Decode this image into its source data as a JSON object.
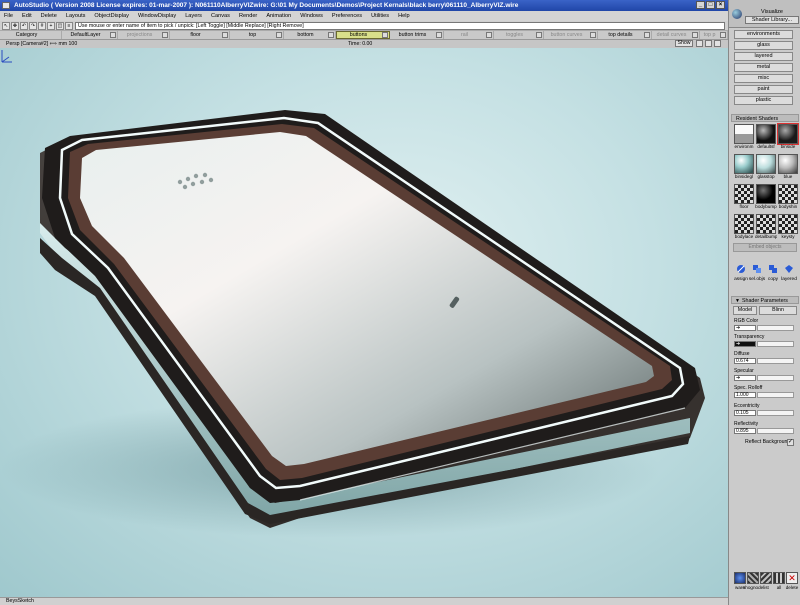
{
  "window": {
    "title": "AutoStudio ( Version 2008  License expires: 01-mar-2007 ): N061110AlberryVIZwire: G:\\01 My Documents\\Demos\\Project Kernals\\black berry\\061110_AlberryVIZ.wire",
    "buttons": [
      "_",
      "□",
      "×"
    ]
  },
  "menu": [
    "File",
    "Edit",
    "Delete",
    "Layouts",
    "ObjectDisplay",
    "WindowDisplay",
    "Layers",
    "Canvas",
    "Render",
    "Animation",
    "Windows",
    "Preferences",
    "Utilities",
    "Help"
  ],
  "prompt": {
    "text": "Use mouse or enter name of item to pick / unpick: [Left Toggle] [Middle Replace] [Right Remove]"
  },
  "shelf": [
    {
      "label": "Category",
      "state": "normal"
    },
    {
      "label": "DefaultLayer",
      "state": "normal"
    },
    {
      "label": "projections",
      "state": "dim"
    },
    {
      "label": "floor",
      "state": "normal"
    },
    {
      "label": "top",
      "state": "normal"
    },
    {
      "label": "bottom",
      "state": "normal"
    },
    {
      "label": "buttons",
      "state": "active"
    },
    {
      "label": "button trims",
      "state": "normal"
    },
    {
      "label": "rail",
      "state": "dim"
    },
    {
      "label": "toggles",
      "state": "dim"
    },
    {
      "label": "button curves",
      "state": "dim"
    },
    {
      "label": "top details",
      "state": "normal"
    },
    {
      "label": "detail curves",
      "state": "dim"
    },
    {
      "label": "top p",
      "state": "dim"
    }
  ],
  "viewinfo": {
    "camera": "Persp [Camera#2]",
    "units_symbol": "⟺ mm",
    "scale": "100",
    "time": "Time: 0.00",
    "show_label": "Show"
  },
  "status": {
    "text": "BeysSketch"
  },
  "visualize": {
    "title": "Visualize",
    "library_button": "Shader Library..."
  },
  "categories": [
    "environments",
    "glass",
    "layered",
    "metal",
    "misc",
    "paint",
    "plastic"
  ],
  "resident_shaders": {
    "title": "Resident Shaders",
    "items": [
      {
        "label": "environm",
        "style": "env",
        "selected": false
      },
      {
        "label": "defaultsf",
        "style": "dark",
        "selected": false
      },
      {
        "label": "binside",
        "style": "darkred",
        "selected": true
      },
      {
        "label": "binsidegl",
        "style": "glass",
        "selected": false
      },
      {
        "label": "glasstop",
        "style": "glass2",
        "selected": false
      },
      {
        "label": "blue",
        "style": "silver",
        "selected": false
      },
      {
        "label": "floor",
        "style": "checker",
        "selected": false
      },
      {
        "label": "bodybump",
        "style": "black",
        "selected": false
      },
      {
        "label": "bodyshin",
        "style": "checker",
        "selected": false
      },
      {
        "label": "bodylace",
        "style": "checker",
        "selected": false
      },
      {
        "label": "detailbump",
        "style": "checker",
        "selected": false
      },
      {
        "label": "keysty",
        "style": "checker",
        "selected": false
      }
    ],
    "embedded_label": "Embed objects"
  },
  "shader_tools": [
    {
      "label": "assign",
      "icon": "assign-icon"
    },
    {
      "label": "sel.objs",
      "icon": "select-objects-icon"
    },
    {
      "label": "copy",
      "icon": "copy-icon"
    },
    {
      "label": "layered",
      "icon": "layered-icon"
    }
  ],
  "shader_params": {
    "title": "Shader Parameters",
    "model_label": "Model",
    "model_value": "Blinn",
    "params": [
      {
        "label": "RGB Color",
        "value": "",
        "arrow": true
      },
      {
        "label": "Transparency",
        "value": "",
        "arrow": true
      },
      {
        "label": "Diffuse",
        "value": "0.674",
        "arrow": false
      },
      {
        "label": "Specular",
        "value": "",
        "arrow": true
      },
      {
        "label": "Spec. Rolloff",
        "value": "1.000",
        "arrow": false
      },
      {
        "label": "Eccentricity",
        "value": "0.105",
        "arrow": false
      },
      {
        "label": "Reflectivity",
        "value": "0.895",
        "arrow": false
      }
    ],
    "reflect_background": "Reflect Background",
    "reflect_checked": "✓"
  },
  "bottom_tools": [
    {
      "label": "ware",
      "icon": "ware-icon"
    },
    {
      "label": "shognode",
      "icon": "show-node-icon"
    },
    {
      "label": "list",
      "icon": "list-icon"
    },
    {
      "label": "all",
      "icon": "all-icon"
    },
    {
      "label": "delete",
      "icon": "delete-icon"
    }
  ],
  "colors": {
    "title_bar": "#2a52b8",
    "viewport_bg": "#c4e0e3",
    "device_body": "#2e2a28",
    "active_layer": "#d9e08a"
  }
}
